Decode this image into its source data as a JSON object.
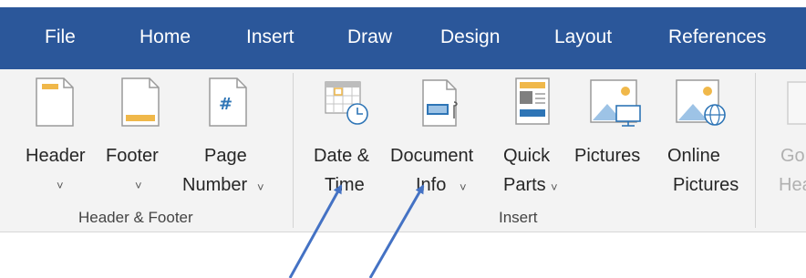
{
  "menu": {
    "tabs": [
      {
        "label": "File"
      },
      {
        "label": "Home"
      },
      {
        "label": "Insert"
      },
      {
        "label": "Draw"
      },
      {
        "label": "Design"
      },
      {
        "label": "Layout"
      },
      {
        "label": "References"
      }
    ]
  },
  "ribbon": {
    "groups": {
      "header_footer": "Header & Footer",
      "insert": "Insert"
    },
    "buttons": {
      "header": {
        "line1": "Header",
        "caret": "˅",
        "icon": "header-page-icon"
      },
      "footer": {
        "line1": "Footer",
        "caret": "˅",
        "icon": "footer-page-icon"
      },
      "page_number": {
        "line1": "Page",
        "line2": "Number",
        "caret": "˅",
        "icon": "page-number-icon"
      },
      "date_time": {
        "line1": "Date &",
        "line2": "Time",
        "icon": "calendar-clock-icon"
      },
      "document_info": {
        "line1": "Document",
        "line2": "Info",
        "caret": "˅",
        "icon": "document-info-icon"
      },
      "quick_parts": {
        "line1": "Quick",
        "line2": "Parts",
        "caret": "˅",
        "icon": "quick-parts-icon"
      },
      "pictures": {
        "line1": "Pictures",
        "icon": "picture-monitor-icon"
      },
      "online_pictures": {
        "line1": "Online",
        "line2": "Pictures",
        "icon": "picture-globe-icon"
      },
      "go_to_header": {
        "line1": "Go",
        "line2": "Hea",
        "icon": "go-to-header-icon"
      }
    }
  },
  "colors": {
    "menubar": "#2b579a",
    "ribbon_bg": "#f3f3f3",
    "arrow": "#4472c4",
    "accent_orange": "#f0b84a",
    "accent_blue": "#2e75b6"
  },
  "annotations": {
    "arrows": 2,
    "arrow_targets": [
      "Date & Time",
      "Document Info"
    ]
  }
}
